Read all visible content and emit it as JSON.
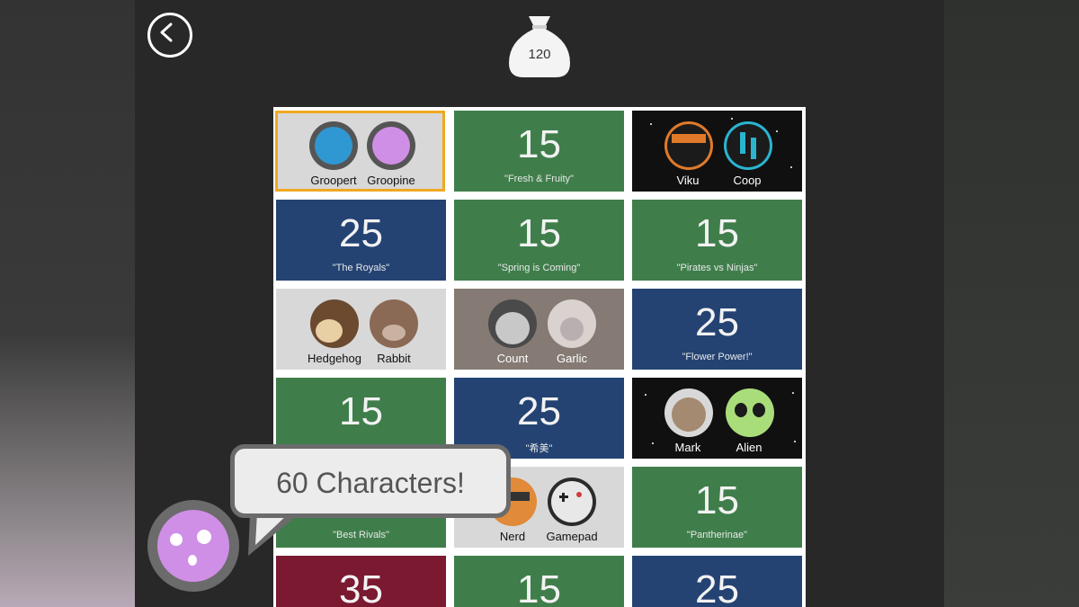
{
  "header": {
    "coins": "120"
  },
  "tiles": [
    {
      "type": "characters",
      "names": [
        "Groopert",
        "Groopine"
      ]
    },
    {
      "type": "pack",
      "price": "15",
      "label": "\"Fresh & Fruity\""
    },
    {
      "type": "characters",
      "names": [
        "Viku",
        "Coop"
      ]
    },
    {
      "type": "pack",
      "price": "25",
      "label": "\"The Royals\""
    },
    {
      "type": "pack",
      "price": "15",
      "label": "\"Spring is Coming\""
    },
    {
      "type": "pack",
      "price": "15",
      "label": "\"Pirates vs Ninjas\""
    },
    {
      "type": "characters",
      "names": [
        "Hedgehog",
        "Rabbit"
      ]
    },
    {
      "type": "characters",
      "names": [
        "Count",
        "Garlic"
      ]
    },
    {
      "type": "pack",
      "price": "25",
      "label": "\"Flower Power!\""
    },
    {
      "type": "pack",
      "price": "15",
      "label": ""
    },
    {
      "type": "pack",
      "price": "25",
      "label": "\"希美\""
    },
    {
      "type": "characters",
      "names": [
        "Mark",
        "Alien"
      ]
    },
    {
      "type": "pack",
      "price": "",
      "label": "\"Best Rivals\""
    },
    {
      "type": "characters",
      "names": [
        "Nerd",
        "Gamepad"
      ]
    },
    {
      "type": "pack",
      "price": "15",
      "label": "\"Pantherinae\""
    },
    {
      "type": "pack",
      "price": "35",
      "label": ""
    },
    {
      "type": "pack",
      "price": "15",
      "label": ""
    },
    {
      "type": "pack",
      "price": "25",
      "label": ""
    }
  ],
  "bubble": {
    "text": "60  Characters!"
  },
  "colors": {
    "green": "#3f7e4b",
    "blue": "#244373",
    "red": "#7a1930",
    "selected": "#f0a821"
  },
  "icons": {
    "back": "chevron-left-icon",
    "coins": "money-bag-icon"
  }
}
